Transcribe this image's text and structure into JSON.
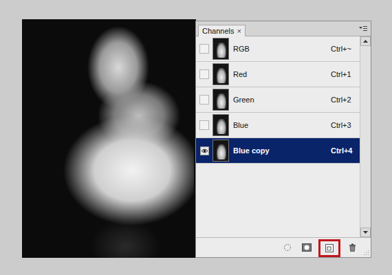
{
  "panel": {
    "title": "Channels",
    "close": "×"
  },
  "channels": [
    {
      "name": "RGB",
      "shortcut": "Ctrl+~",
      "visible": false,
      "selected": false
    },
    {
      "name": "Red",
      "shortcut": "Ctrl+1",
      "visible": false,
      "selected": false
    },
    {
      "name": "Green",
      "shortcut": "Ctrl+2",
      "visible": false,
      "selected": false
    },
    {
      "name": "Blue",
      "shortcut": "Ctrl+3",
      "visible": false,
      "selected": false
    },
    {
      "name": "Blue copy",
      "shortcut": "Ctrl+4",
      "visible": true,
      "selected": true
    }
  ],
  "toolbar": [
    {
      "kind": "selection",
      "highlighted": false
    },
    {
      "kind": "mask",
      "highlighted": false
    },
    {
      "kind": "new",
      "highlighted": true
    },
    {
      "kind": "delete",
      "highlighted": false
    }
  ]
}
